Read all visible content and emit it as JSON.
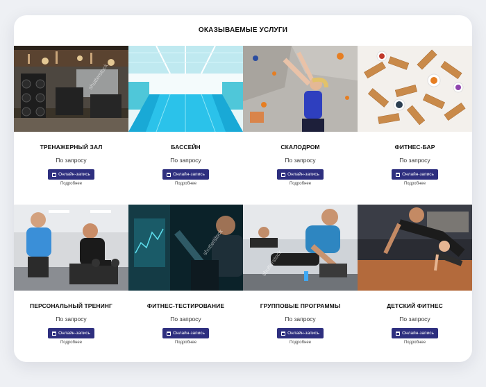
{
  "title": "ОКАЗЫВАЕМЫЕ УСЛУГИ",
  "button_label": "Онлайн-запись",
  "more_label": "Подробнее",
  "watermark": "shutterstock",
  "services": [
    {
      "name": "ТРЕНАЖЕРНЫЙ ЗАЛ",
      "price": "По запросу",
      "photo": "gym-interior"
    },
    {
      "name": "БАССЕЙН",
      "price": "По запросу",
      "photo": "indoor-pool"
    },
    {
      "name": "СКАЛОДРОМ",
      "price": "По запросу",
      "photo": "climbing-wall"
    },
    {
      "name": "ФИТНЕС-БАР",
      "price": "По запросу",
      "photo": "protein-bars"
    },
    {
      "name": "ПЕРСОНАЛЬНЫЙ ТРЕНИНГ",
      "price": "По запросу",
      "photo": "personal-trainer"
    },
    {
      "name": "ФИТНЕС-ТЕСТИРОВАНИЕ",
      "price": "По запросу",
      "photo": "fitness-test"
    },
    {
      "name": "ГРУППОВЫЕ ПРОГРАММЫ",
      "price": "По запросу",
      "photo": "group-workout"
    },
    {
      "name": "ДЕТСКИЙ ФИТНЕС",
      "price": "По запросу",
      "photo": "kids-fitness"
    }
  ],
  "colors": {
    "button": "#2e2f7f",
    "background": "#eef0f4"
  }
}
